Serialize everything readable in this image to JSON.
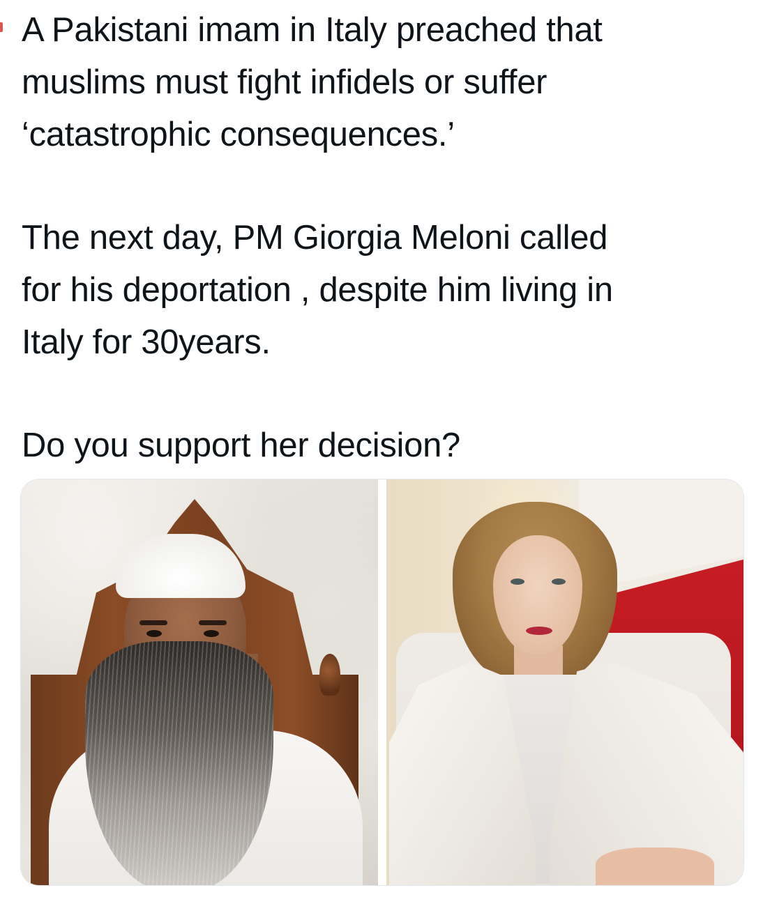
{
  "tweet": {
    "paragraphs": [
      {
        "lines": [
          "A Pakistani imam in Italy preached that",
          "muslims must fight infidels or suffer",
          "‘catastrophic consequences.’"
        ]
      },
      {
        "lines": [
          "The next day, PM Giorgia Meloni called",
          "for his deportation , despite him living in",
          "Italy for 30years."
        ]
      },
      {
        "lines": [
          "Do you support her decision?"
        ]
      }
    ]
  },
  "media": {
    "photos": [
      {
        "subject": "imam-photo"
      },
      {
        "subject": "meloni-photo"
      }
    ]
  },
  "colors": {
    "text": "#0f1419",
    "background": "#ffffff",
    "flag_red": "#c71d24"
  }
}
